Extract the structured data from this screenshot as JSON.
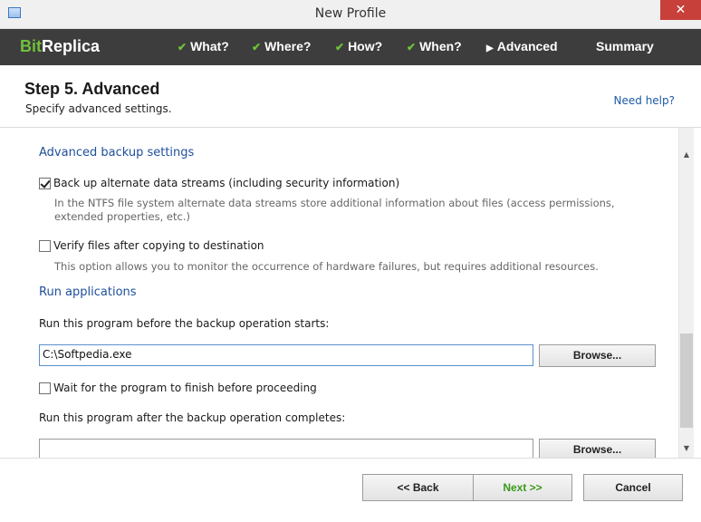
{
  "window": {
    "title": "New Profile",
    "close_glyph": "✕"
  },
  "brand": {
    "prefix": "Bit",
    "suffix": "Replica"
  },
  "steps": [
    {
      "label": "What?",
      "state": "done"
    },
    {
      "label": "Where?",
      "state": "done"
    },
    {
      "label": "How?",
      "state": "done"
    },
    {
      "label": "When?",
      "state": "done"
    },
    {
      "label": "Advanced",
      "state": "current"
    },
    {
      "label": "Summary",
      "state": "pending"
    }
  ],
  "header": {
    "title": "Step 5. Advanced",
    "subtitle": "Specify advanced settings.",
    "help_link": "Need help?"
  },
  "advanced": {
    "heading": "Advanced backup settings",
    "streams": {
      "label": "Back up alternate data streams (including security information)",
      "checked": true,
      "description": "In the NTFS file system alternate data streams store additional information about files (access permissions, extended properties, etc.)"
    },
    "verify": {
      "label": "Verify files after copying to destination",
      "checked": false,
      "description": "This option allows you to monitor the occurrence of hardware failures, but requires additional resources."
    }
  },
  "run_apps": {
    "heading": "Run applications",
    "before_label": "Run this program before the backup operation starts:",
    "before_value": "C:\\Softpedia.exe",
    "browse_label": "Browse...",
    "wait_label": "Wait for the program to finish before proceeding",
    "wait_checked": false,
    "after_label": "Run this program after the backup operation completes:",
    "after_value": ""
  },
  "footer": {
    "back_label": "<< Back",
    "next_label": "Next >>",
    "cancel_label": "Cancel"
  },
  "colors": {
    "nav_bg": "#3d3d3d",
    "check_green": "#6fc23a",
    "link_blue": "#1e5aa8",
    "close_red": "#c7403a"
  }
}
